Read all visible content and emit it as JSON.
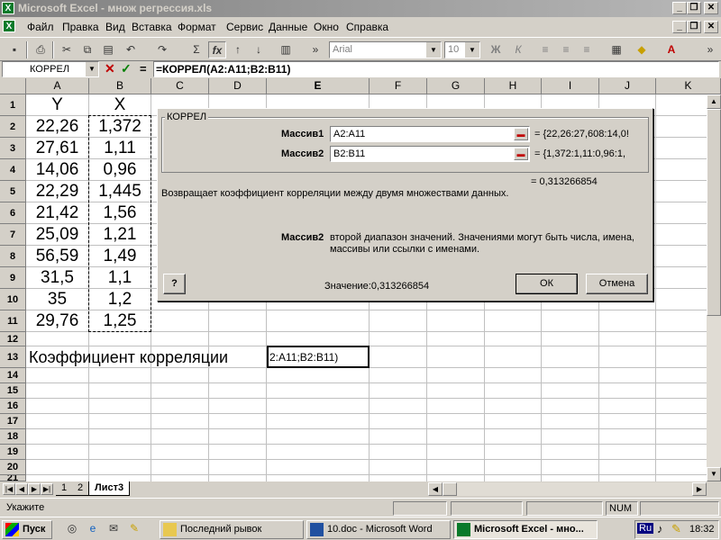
{
  "window": {
    "title": "Microsoft Excel - множ регрессия.xls",
    "controls": [
      "_",
      "❐",
      "✕"
    ]
  },
  "menu": {
    "items": [
      "Файл",
      "Правка",
      "Вид",
      "Вставка",
      "Формат",
      "Сервис",
      "Данные",
      "Окно",
      "Справка"
    ]
  },
  "toolbar": {
    "font_name": "Arial",
    "font_size": "10"
  },
  "formula_bar": {
    "name_box": "КОРРЕЛ",
    "cancel": "✕",
    "enter": "✓",
    "equals": "=",
    "formula": "=КОРРЕЛ(A2:A11;B2:B11)"
  },
  "grid": {
    "columns": [
      "A",
      "B",
      "C",
      "D",
      "E",
      "F",
      "G",
      "H",
      "I",
      "J",
      "K"
    ],
    "rows": [
      "1",
      "2",
      "3",
      "4",
      "5",
      "6",
      "7",
      "8",
      "9",
      "10",
      "11",
      "12",
      "13",
      "14",
      "15",
      "16",
      "17",
      "18",
      "19",
      "20",
      "21"
    ],
    "header_Y": "Y",
    "header_X": "X",
    "col_Y": [
      "22,26",
      "27,61",
      "14,06",
      "22,29",
      "21,42",
      "25,09",
      "56,59",
      "31,5",
      "35",
      "29,76"
    ],
    "col_X": [
      "1,372",
      "1,11",
      "0,96",
      "1,445",
      "1,56",
      "1,21",
      "1,49",
      "1,1",
      "1,2",
      "1,25"
    ],
    "label_row13": "Коэффициент корреляции",
    "editing_cell": "2:A11;B2:B11)"
  },
  "dialog": {
    "group_title": "КОРРЕЛ",
    "arg1_label": "Массив1",
    "arg1_value": "A2:A11",
    "arg1_result": "= {22,26:27,608:14,0!",
    "arg2_label": "Массив2",
    "arg2_value": "B2:B11",
    "arg2_result": "= {1,372:1,11:0,96:1,",
    "func_result": "= 0,313266854",
    "description": "Возвращает коэффициент корреляции между двумя множествами данных.",
    "arg_help_label": "Массив2",
    "arg_help_text": "второй диапазон значений. Значениями могут быть числа, имена,",
    "arg_help_text2": "массивы или ссылки с именами.",
    "help_button": "?",
    "value_text": "Значение:0,313266854",
    "ok_label": "ОК",
    "cancel_label": "Отмена"
  },
  "sheet_tabs": {
    "tabs": [
      "1",
      "2",
      "Лист3"
    ],
    "active": "Лист3"
  },
  "status_bar": {
    "mode": "Укажите",
    "num": "NUM"
  },
  "taskbar": {
    "start": "Пуск",
    "tasks": [
      "Последний рывок",
      "10.doc - Microsoft Word",
      "Microsoft Excel - мно..."
    ],
    "lang": "Ru",
    "time": "18:32"
  }
}
